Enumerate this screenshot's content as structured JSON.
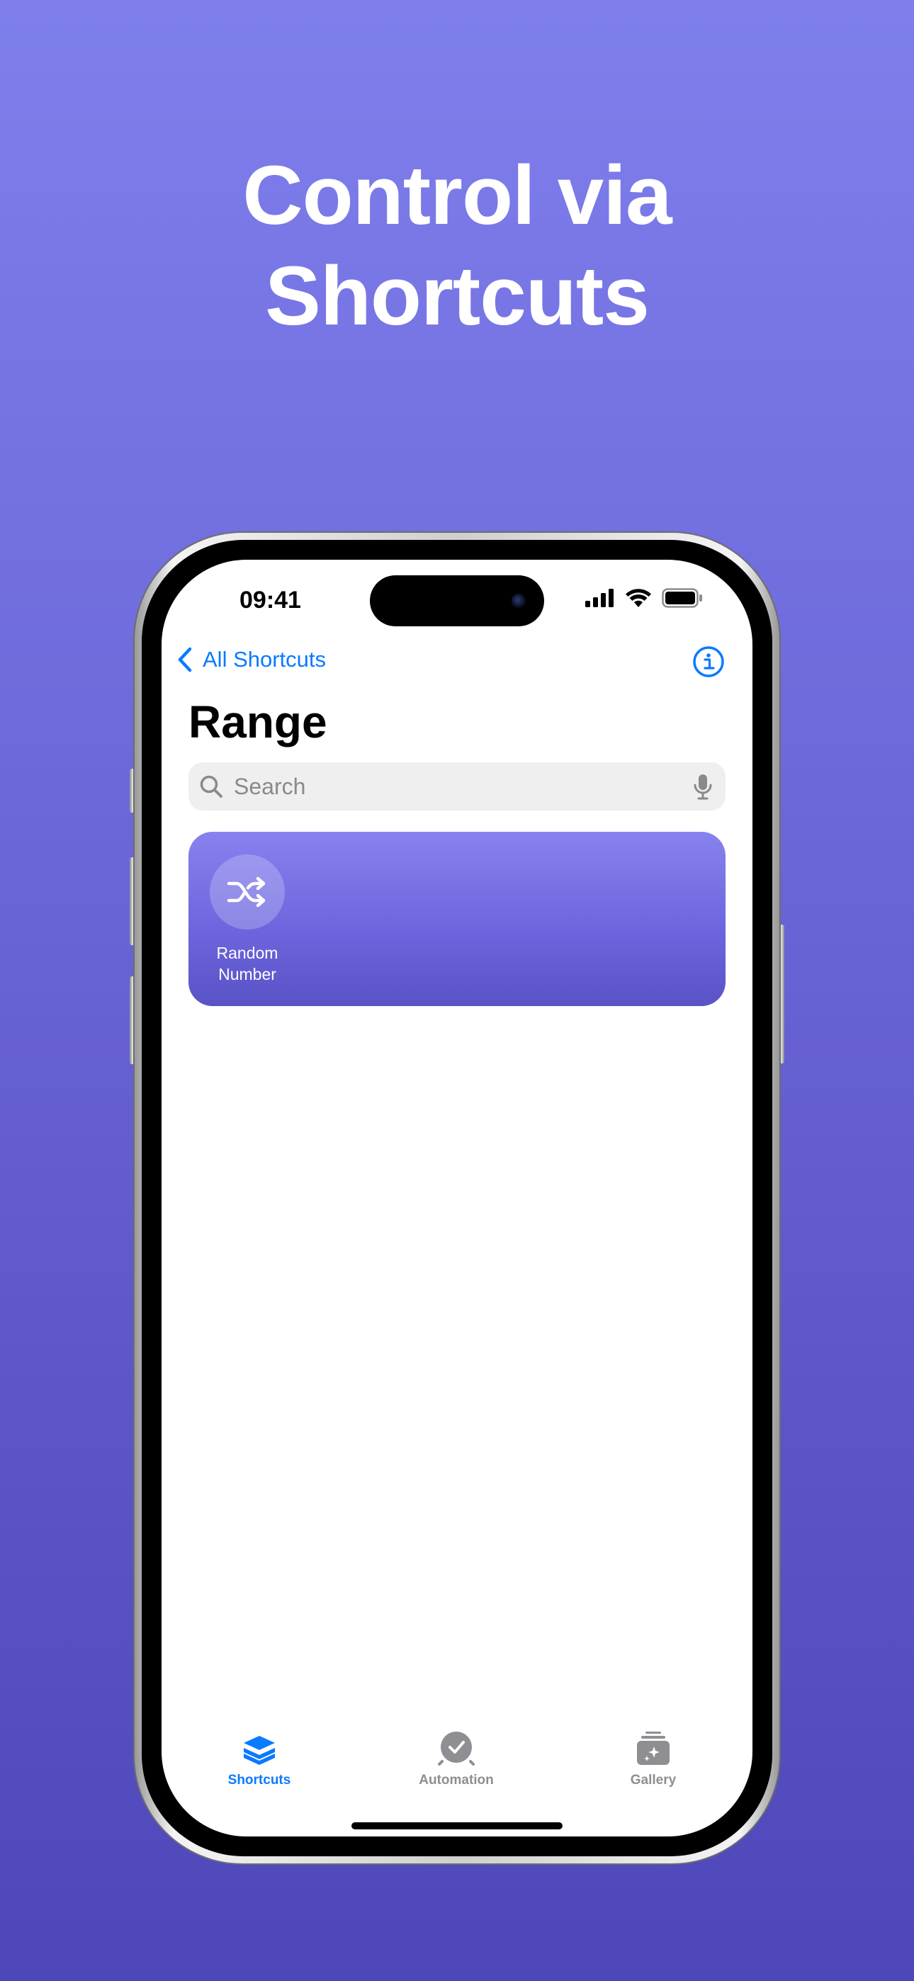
{
  "headline": {
    "line1": "Control via",
    "line2": "Shortcuts"
  },
  "status_bar": {
    "time": "09:41",
    "icons": [
      "cellular-signal-icon",
      "wifi-icon",
      "battery-icon"
    ]
  },
  "nav": {
    "back_label": "All Shortcuts",
    "back_icon": "chevron-left-icon",
    "info_icon": "info-circle-icon"
  },
  "page": {
    "title": "Range"
  },
  "search": {
    "placeholder": "Search",
    "search_icon": "magnifying-glass-icon",
    "mic_icon": "microphone-icon"
  },
  "shortcuts": [
    {
      "label_line1": "Random",
      "label_line2": "Number",
      "icon": "shuffle-icon"
    }
  ],
  "tabbar": {
    "tabs": [
      {
        "label": "Shortcuts",
        "icon": "layers-icon",
        "active": true
      },
      {
        "label": "Automation",
        "icon": "clock-check-icon",
        "active": false
      },
      {
        "label": "Gallery",
        "icon": "gallery-stack-icon",
        "active": false
      }
    ]
  },
  "colors": {
    "accent": "#0a7aff",
    "background_top": "#7f7fec",
    "background_bottom": "#4e47b9",
    "tile_top": "#8882ef",
    "tile_bottom": "#5a52c6",
    "inactive_tab": "#8e8e93"
  }
}
